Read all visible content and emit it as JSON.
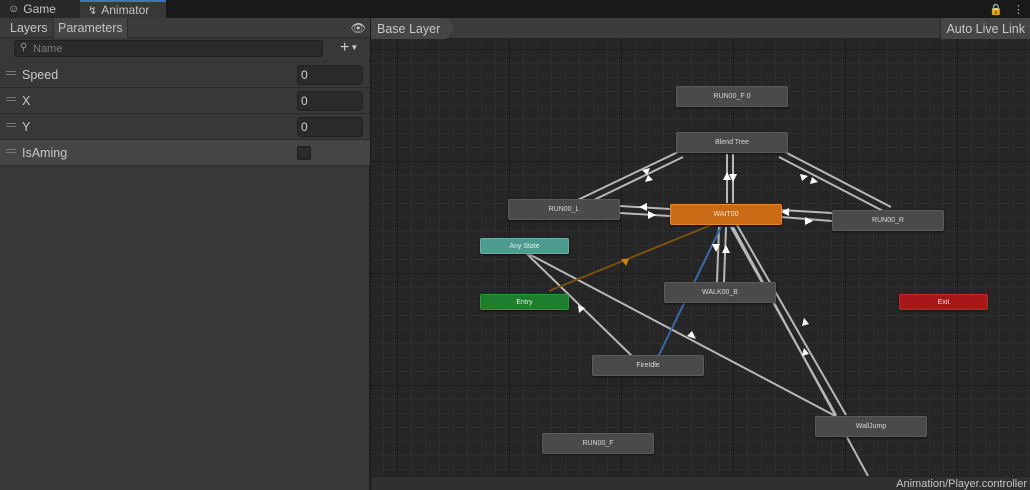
{
  "tabs": {
    "game": "Game",
    "animator": "Animator"
  },
  "left_panel": {
    "tab_layers": "Layers",
    "tab_parameters": "Parameters",
    "search_placeholder": "Name",
    "add_label": "+",
    "parameters": [
      {
        "name": "Speed",
        "type": "float",
        "value": "0"
      },
      {
        "name": "X",
        "type": "float",
        "value": "0"
      },
      {
        "name": "Y",
        "type": "float",
        "value": "0"
      },
      {
        "name": "IsAming",
        "type": "bool",
        "value": false
      }
    ]
  },
  "graph": {
    "breadcrumb": "Base Layer",
    "auto_live_link": "Auto Live Link",
    "states": {
      "run_f0": "RUN00_F 0",
      "blend_tree": "Blend Tree",
      "run_l": "RUN00_L",
      "wait": "WAIT00",
      "run_r": "RUN00_R",
      "any_state": "Any State",
      "entry": "Entry",
      "walk_b": "WALK00_B",
      "exit": "Exit",
      "fireidle": "FireIdle",
      "walljump": "WallJump",
      "run_f": "RUN00_F"
    },
    "colors": {
      "default_state": "#4a4a4a",
      "default_state_active": "#c96a14",
      "any_state": "#4d9b8e",
      "entry": "#1c7e2c",
      "exit": "#a81818",
      "transition": "#b8b8b8",
      "entry_transition": "#8a5a10",
      "selected_transition": "#3a6aa8"
    }
  },
  "status": {
    "controller_path": "Animation/Player.controller"
  }
}
